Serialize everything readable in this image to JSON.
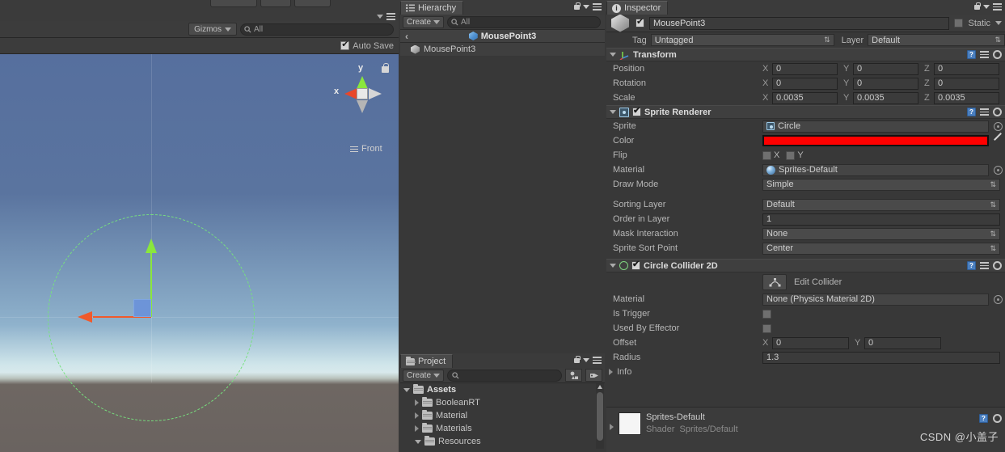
{
  "scene_view": {
    "gizmos_label": "Gizmos",
    "search_placeholder": "All",
    "auto_save_label": "Auto Save",
    "orientation": {
      "x_label": "x",
      "y_label": "y",
      "view_label": "Front"
    }
  },
  "hierarchy": {
    "tab_label": "Hierarchy",
    "create_label": "Create",
    "search_placeholder": "All",
    "breadcrumb": "MousePoint3",
    "items": [
      {
        "label": "MousePoint3",
        "selected": true
      }
    ]
  },
  "project": {
    "tab_label": "Project",
    "create_label": "Create",
    "search_placeholder": "",
    "tree": [
      {
        "label": "Assets",
        "depth": 0,
        "expanded": true,
        "bold": true
      },
      {
        "label": "BooleanRT",
        "depth": 1,
        "expanded": false,
        "bold": false
      },
      {
        "label": "Material",
        "depth": 1,
        "expanded": false,
        "bold": false
      },
      {
        "label": "Materials",
        "depth": 1,
        "expanded": false,
        "bold": false
      },
      {
        "label": "Resources",
        "depth": 1,
        "expanded": true,
        "bold": false
      }
    ]
  },
  "inspector": {
    "tab_label": "Inspector",
    "object_name": "MousePoint3",
    "object_enabled": true,
    "static_label": "Static",
    "tag_label": "Tag",
    "tag_value": "Untagged",
    "layer_label": "Layer",
    "layer_value": "Default",
    "transform": {
      "title": "Transform",
      "rows": [
        {
          "name": "Position",
          "x": "0",
          "y": "0",
          "z": "0"
        },
        {
          "name": "Rotation",
          "x": "0",
          "y": "0",
          "z": "0"
        },
        {
          "name": "Scale",
          "x": "0.0035",
          "y": "0.0035",
          "z": "0.0035"
        }
      ]
    },
    "sprite_renderer": {
      "title": "Sprite Renderer",
      "enabled": true,
      "sprite_label": "Sprite",
      "sprite_value": "Circle",
      "color_label": "Color",
      "color_value": "#FF0000",
      "flip_label": "Flip",
      "flip_x_label": "X",
      "flip_y_label": "Y",
      "flip_x": false,
      "flip_y": false,
      "material_label": "Material",
      "material_value": "Sprites-Default",
      "draw_mode_label": "Draw Mode",
      "draw_mode_value": "Simple",
      "sorting_layer_label": "Sorting Layer",
      "sorting_layer_value": "Default",
      "order_in_layer_label": "Order in Layer",
      "order_in_layer_value": "1",
      "mask_interaction_label": "Mask Interaction",
      "mask_interaction_value": "None",
      "sprite_sort_point_label": "Sprite Sort Point",
      "sprite_sort_point_value": "Center"
    },
    "circle_collider": {
      "title": "Circle Collider 2D",
      "enabled": true,
      "edit_collider_label": "Edit Collider",
      "material_label": "Material",
      "material_value": "None (Physics Material 2D)",
      "is_trigger_label": "Is Trigger",
      "is_trigger": false,
      "used_by_effector_label": "Used By Effector",
      "used_by_effector": false,
      "offset_label": "Offset",
      "offset_x": "0",
      "offset_y": "0",
      "radius_label": "Radius",
      "radius_value": "1.3",
      "info_label": "Info"
    },
    "material_preview": {
      "name": "Sprites-Default",
      "shader_label": "Shader",
      "shader_value": "Sprites/Default"
    }
  },
  "watermark": "CSDN @小盖子"
}
